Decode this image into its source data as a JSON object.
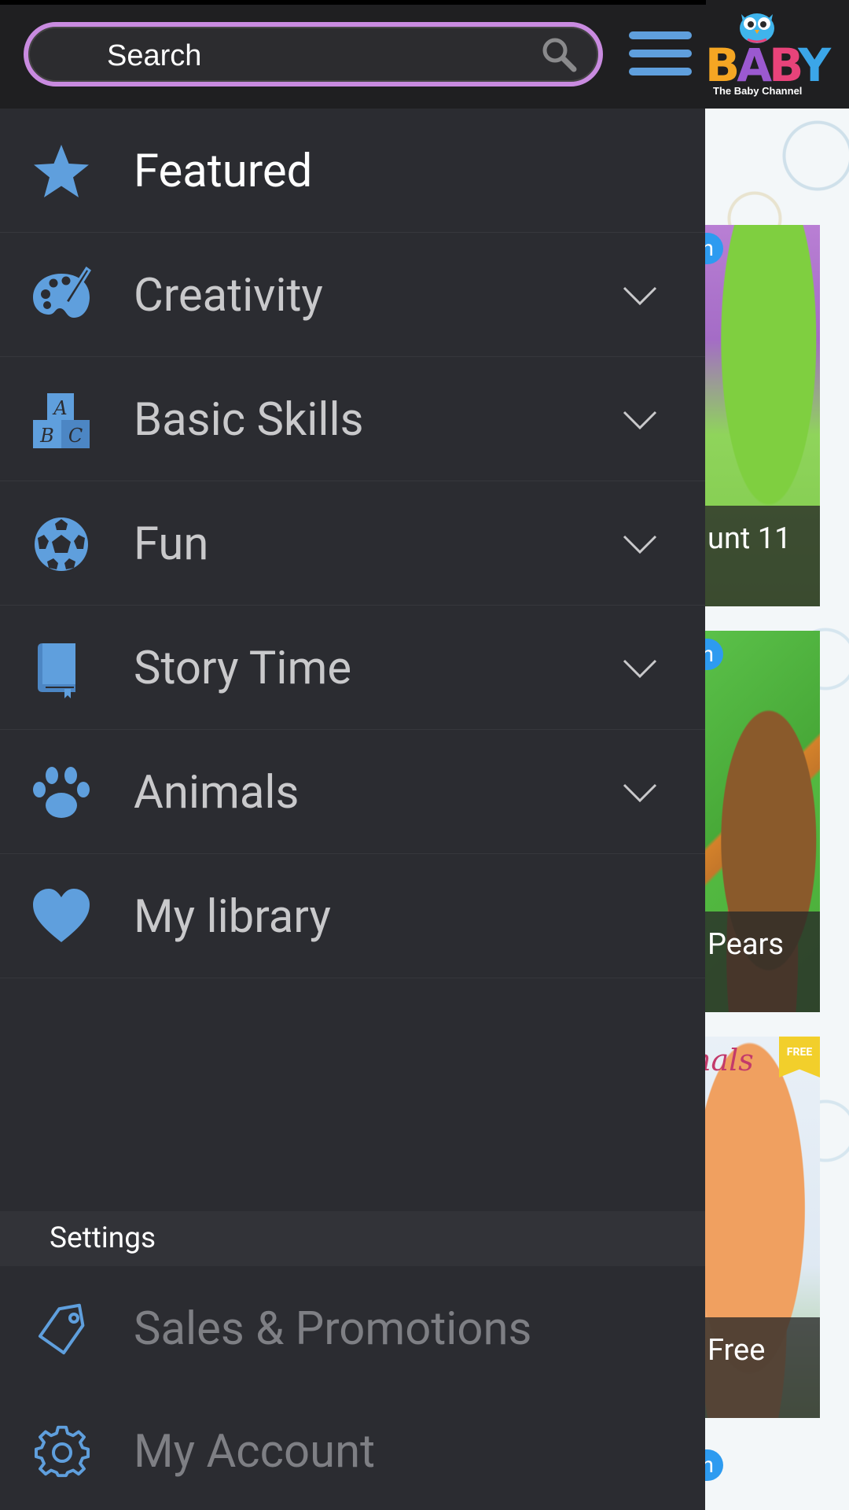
{
  "app": {
    "logo_word": [
      "B",
      "A",
      "B",
      "Y"
    ],
    "logo_subtitle": "The Baby Channel"
  },
  "search": {
    "placeholder": "Search",
    "value": ""
  },
  "drawer": {
    "items": [
      {
        "label": "Featured",
        "icon": "star-icon",
        "expandable": false,
        "active": true
      },
      {
        "label": "Creativity",
        "icon": "palette-icon",
        "expandable": true
      },
      {
        "label": "Basic Skills",
        "icon": "abc-blocks-icon",
        "expandable": true
      },
      {
        "label": "Fun",
        "icon": "soccer-ball-icon",
        "expandable": true
      },
      {
        "label": "Story Time",
        "icon": "book-icon",
        "expandable": true
      },
      {
        "label": "Animals",
        "icon": "paw-icon",
        "expandable": true
      },
      {
        "label": "My library",
        "icon": "heart-icon",
        "expandable": false
      }
    ],
    "settings_header": "Settings",
    "settings_items": [
      {
        "label": "Sales & Promotions",
        "icon": "tag-icon"
      },
      {
        "label": "My Account",
        "icon": "gear-icon"
      }
    ]
  },
  "background_cards": [
    {
      "caption": "unt 11",
      "badge": "n"
    },
    {
      "caption": " Pears",
      "badge": "n"
    },
    {
      "caption": " Free",
      "title": "nals",
      "ribbon": "FREE"
    }
  ],
  "background_badge_bottom": "n",
  "colors": {
    "accent_blue": "#5f9fdd",
    "search_border": "#c98be0",
    "drawer_bg": "#2b2c31",
    "topbar_bg": "#1f1f21"
  }
}
